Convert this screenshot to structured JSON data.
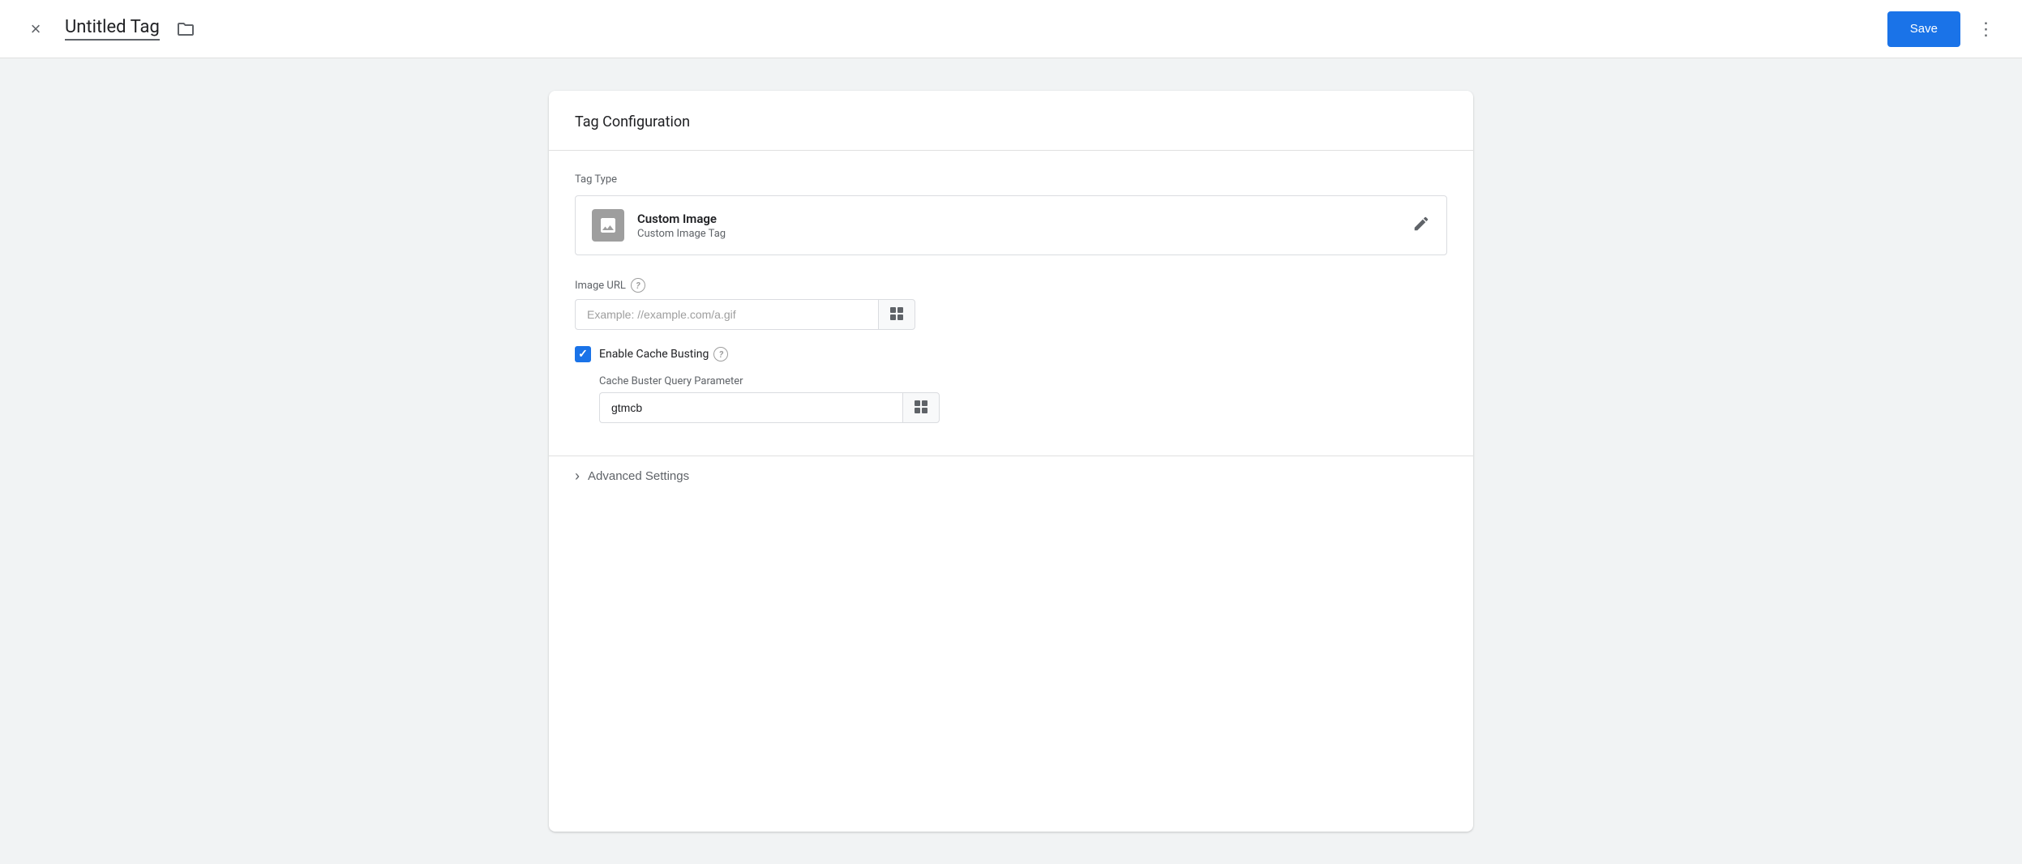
{
  "header": {
    "title": "Untitled Tag",
    "save_label": "Save",
    "close_icon": "×",
    "folder_icon": "🗀",
    "more_icon": "⋮"
  },
  "card": {
    "title": "Tag Configuration",
    "tag_type_label": "Tag Type",
    "tag_type_name": "Custom Image",
    "tag_type_desc": "Custom Image Tag",
    "image_url_label": "Image URL",
    "image_url_placeholder": "Example: //example.com/a.gif",
    "cache_busting_label": "Enable Cache Busting",
    "cache_buster_param_label": "Cache Buster Query Parameter",
    "cache_buster_value": "gtmcb",
    "advanced_label": "Advanced Settings"
  }
}
